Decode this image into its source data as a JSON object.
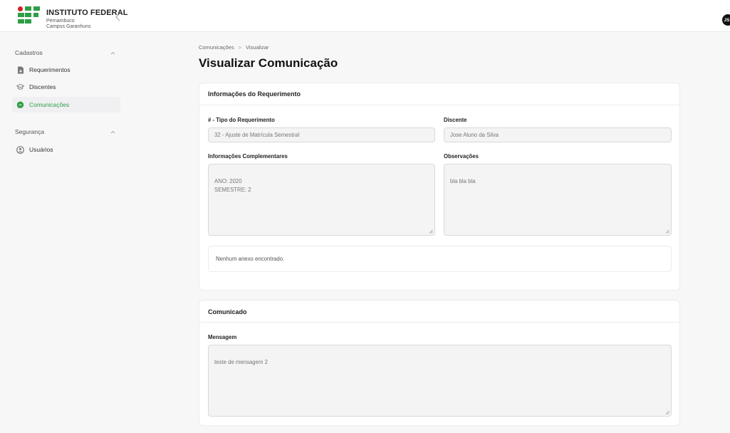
{
  "header": {
    "brand_title": "INSTITUTO FEDERAL",
    "brand_line2": "Pernambuco",
    "brand_line3": "Campus Garanhuns",
    "avatar_initials": "JS"
  },
  "sidebar": {
    "sections": [
      {
        "title": "Cadastros",
        "items": [
          {
            "label": "Requerimentos",
            "icon": "document-icon"
          },
          {
            "label": "Discentes",
            "icon": "graduation-cap-icon"
          },
          {
            "label": "Comunicações",
            "icon": "chat-bubble-icon",
            "active": true
          }
        ]
      },
      {
        "title": "Segurança",
        "items": [
          {
            "label": "Usuários",
            "icon": "user-circle-icon"
          }
        ]
      }
    ],
    "accent_color": "#2e9e46"
  },
  "breadcrumb": {
    "parent": "Comunicações",
    "separator": ">",
    "current": "Visualizar"
  },
  "page_title": "Visualizar Comunicação",
  "requerimento": {
    "title": "Informações do Requerimento",
    "tipo_label": "# - Tipo do Requerimento",
    "tipo_value": "32 - Ajuste de Matrícula Semestral",
    "discente_label": "Discente",
    "discente_value": "Jose Aluno da Silva",
    "info_label": "Informações Complementares",
    "info_value": "ANO: 2020\nSEMESTRE:  2",
    "obs_label": "Observações",
    "obs_value": "bla bla bla",
    "anexo_text": "Nenhum anexo encontrado."
  },
  "comunicado": {
    "title": "Comunicado",
    "mensagem_label": "Mensagem",
    "mensagem_value": "teste de mensagem 2"
  }
}
